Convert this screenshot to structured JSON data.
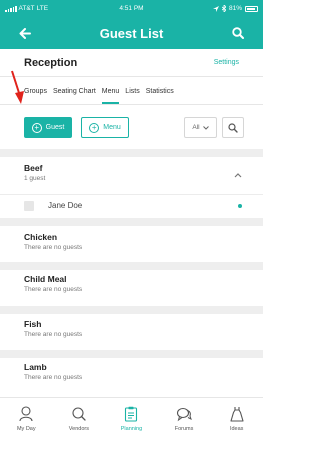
{
  "status_bar": {
    "carrier": "AT&T",
    "network": "LTE",
    "time": "4:51 PM",
    "battery": "81%"
  },
  "nav": {
    "title": "Guest List",
    "back_icon": "arrow-left-icon",
    "search_icon": "search-icon"
  },
  "section": {
    "name": "Reception",
    "settings_label": "Settings"
  },
  "tabs": [
    {
      "label": "Groups",
      "active": false
    },
    {
      "label": "Seating Chart",
      "active": false
    },
    {
      "label": "Menu",
      "active": true
    },
    {
      "label": "Lists",
      "active": false
    },
    {
      "label": "Statistics",
      "active": false
    }
  ],
  "actions": {
    "add_guest_label": "Guest",
    "add_menu_label": "Menu",
    "filter_value": "All"
  },
  "groups": [
    {
      "name": "Beef",
      "subtitle": "1 guest",
      "guests": [
        "Jane Doe"
      ]
    },
    {
      "name": "Chicken",
      "subtitle": "There are no guests"
    },
    {
      "name": "Child Meal",
      "subtitle": "There are no guests"
    },
    {
      "name": "Fish",
      "subtitle": "There are no guests"
    },
    {
      "name": "Lamb",
      "subtitle": "There are no guests"
    }
  ],
  "tab_bar": [
    {
      "label": "My Day",
      "icon": "person-icon",
      "active": false
    },
    {
      "label": "Vendors",
      "icon": "search-icon",
      "active": false
    },
    {
      "label": "Planning",
      "icon": "clipboard-icon",
      "active": true
    },
    {
      "label": "Forums",
      "icon": "chat-bubbles-icon",
      "active": false
    },
    {
      "label": "Ideas",
      "icon": "dress-icon",
      "active": false
    }
  ],
  "colors": {
    "accent": "#1ab3a6",
    "divider": "#eeeeee",
    "annotation_arrow": "#e0231c"
  }
}
